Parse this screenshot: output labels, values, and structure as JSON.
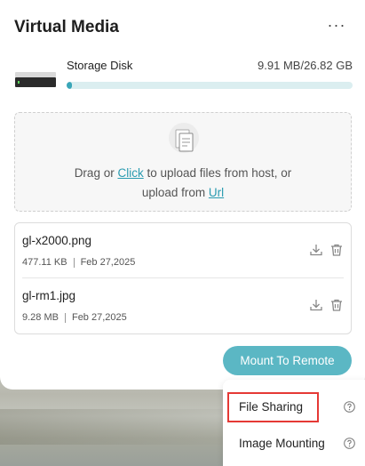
{
  "panel": {
    "title": "Virtual Media",
    "more_label": "···"
  },
  "storage": {
    "name": "Storage Disk",
    "size_text": "9.91 MB/26.82 GB",
    "usage_fraction": 0.0004
  },
  "dropzone": {
    "line1_prefix": "Drag or ",
    "click_link": "Click",
    "line1_suffix": " to upload files from host, or",
    "line2_prefix": "upload from ",
    "url_link": "Url"
  },
  "files": [
    {
      "name": "gl-x2000.png",
      "size": "477.11 KB",
      "date": "Feb 27,2025"
    },
    {
      "name": "gl-rm1.jpg",
      "size": "9.28 MB",
      "date": "Feb 27,2025"
    }
  ],
  "mount_button": {
    "label": "Mount To Remote"
  },
  "dropdown_menu": {
    "items": [
      {
        "label": "File Sharing",
        "highlighted": true
      },
      {
        "label": "Image Mounting",
        "highlighted": false
      }
    ]
  },
  "colors": {
    "accent": "#5bb7c4",
    "link": "#2a9bb0",
    "progress": "#3aa6b8",
    "highlight": "#e53935"
  },
  "icons": {
    "more": "more-horizontal-icon",
    "disk": "storage-disk-icon",
    "upload": "upload-files-icon",
    "download": "download-icon",
    "delete": "trash-icon",
    "help": "help-circle-icon"
  }
}
